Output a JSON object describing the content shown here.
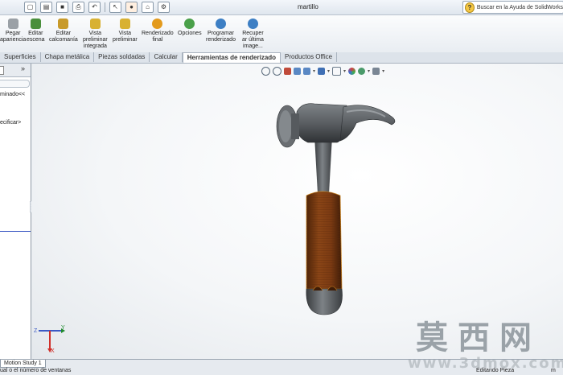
{
  "window": {
    "title": "martillo"
  },
  "help_search": {
    "placeholder": "Buscar en la Ayuda de SolidWorks"
  },
  "ribbon": {
    "tools": [
      {
        "id": "pegar-apariencia",
        "label": "Pegar\napariencia",
        "icon": "paste-appearance-icon",
        "color": "#9aa0a6"
      },
      {
        "id": "editar-escena",
        "label": "Editar\nescena",
        "icon": "scene-icon",
        "color": "#4a8f3c"
      },
      {
        "id": "editar-calcomania",
        "label": "Editar\ncalcomanía",
        "icon": "decal-icon",
        "color": "#c89a2a"
      },
      {
        "id": "vista-preliminar-integrada",
        "label": "Vista\npreliminar\nintegrada",
        "icon": "integrated-preview-icon",
        "color": "#d8b133"
      },
      {
        "id": "vista-preliminar",
        "label": "Vista\npreliminar",
        "icon": "preview-window-icon",
        "color": "#d8b133"
      },
      {
        "id": "renderizado-final",
        "label": "Renderizado\nfinal",
        "icon": "final-render-icon",
        "color": "#e39a1c"
      },
      {
        "id": "opciones",
        "label": "Opciones",
        "icon": "options-icon",
        "color": "#4aa04a"
      },
      {
        "id": "programar-renderizado",
        "label": "Programar\nrenderizado",
        "icon": "schedule-render-icon",
        "color": "#3d7fc4"
      },
      {
        "id": "recuperar-ultima-imagen",
        "label": "Recuper\nar última\nimage...",
        "icon": "recover-image-icon",
        "color": "#3d7fc4"
      }
    ]
  },
  "tabs": [
    {
      "label": "Superficies",
      "active": false
    },
    {
      "label": "Chapa metálica",
      "active": false
    },
    {
      "label": "Piezas soldadas",
      "active": false
    },
    {
      "label": "Calcular",
      "active": false
    },
    {
      "label": "Herramientas de renderizado",
      "active": true
    },
    {
      "label": "Productos Office",
      "active": false
    }
  ],
  "left_panel": {
    "expand_symbol": "»",
    "line1": "minado<<",
    "line2": "ecificar>"
  },
  "status": {
    "motion_tab": "Motion Study 1",
    "text": "ual o el número de ventanas",
    "mode": "Editando Pieza",
    "right": "m"
  },
  "watermark": {
    "chars": [
      "莫",
      "西",
      "网"
    ],
    "url": "www.3dmox.com"
  },
  "colors": {
    "accent": "#3b59c4",
    "handle": "#7a3a12",
    "metal": "#5c6064"
  }
}
